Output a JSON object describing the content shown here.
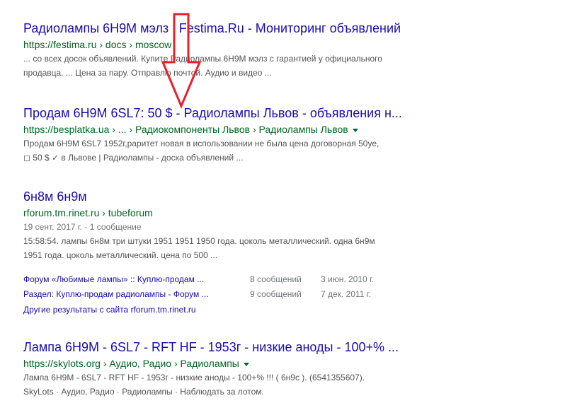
{
  "results": [
    {
      "title": "Радиолампы 6Н9М мэлз | Festima.Ru - Мониторинг объявлений",
      "url": "https://festima.ru › docs › moscow",
      "snippet_line1": "... со всех досок объявлений. Купите Радиолампы 6Н9М мэлз с гарантией у официального",
      "snippet_line2": "продавца. ... Цена за пару. Отправлю почтой. Аудио и видео ..."
    },
    {
      "title": "Продам 6Н9М 6SL7: 50 $ - Радиолампы Львов - объявления н...",
      "url": "https://besplatka.ua › ... › Радиокомпоненты Львов › Радиолампы Львов",
      "snippet_line1": "Продам 6Н9М 6SL7 1952г,раритет новая в использовании не была цена договорная 50уе,",
      "snippet_line2": "◻ 50 $ ✓ в Львове | Радиолампы - доска объявлений ..."
    },
    {
      "title": "6н8м 6н9м",
      "url": "rforum.tm.rinet.ru › tubeforum",
      "date": "19 сент. 2017 г. - 1 сообщение",
      "snippet_line1": "15:58:54. лампы 6н8м три штуки 1951 1951 1950 года. цоколь металлический. одна 6н9м",
      "snippet_line2": "1951 года. цоколь металлический. цена по 500 ...",
      "sublinks": [
        {
          "text": "Форум «Любимые лампы» :: Куплю-продам ...",
          "count": "8 сообщений",
          "date": "3 июн. 2010 г."
        },
        {
          "text": "Раздел: Куплю-продам радиолампы - Форум ...",
          "count": "9 сообщений",
          "date": "7 дек. 2011 г."
        }
      ],
      "more": "Другие результаты с сайта rforum.tm.rinet.ru"
    },
    {
      "title": "Лампа 6Н9М - 6SL7 - RFT HF - 1953г - низкие аноды - 100+% ...",
      "url": "https://skylots.org › Аудио, Радио › Радиолампы",
      "snippet_line1": "Лампа 6Н9М - 6SL7 - RFT HF - 1953г - низкие аноды - 100+% !!! ( 6н9с ). (6541355607).",
      "snippet_line2": "SkyLots · Аудио, Радио · Радиолампы · Наблюдать за лотом."
    }
  ],
  "annotation": {
    "color": "#e8202a",
    "icon": "red-down-arrow-icon"
  }
}
